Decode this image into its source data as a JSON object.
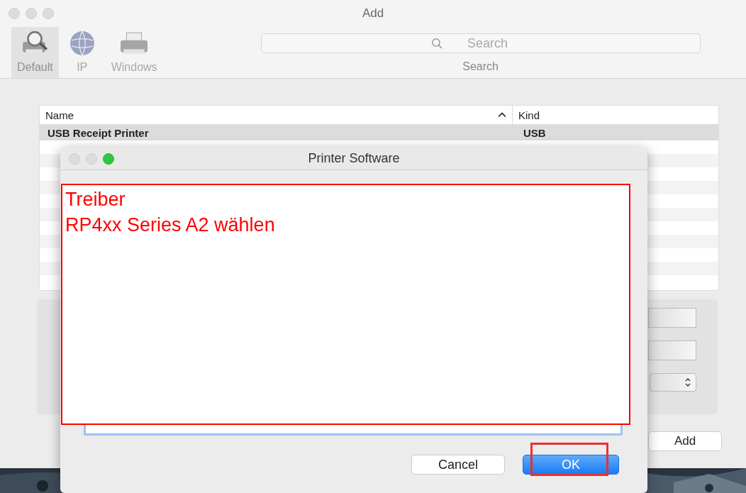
{
  "window": {
    "title": "Add",
    "toolbar": [
      {
        "label": "Default",
        "kind": "default",
        "selected": true
      },
      {
        "label": "IP",
        "kind": "ip",
        "selected": false
      },
      {
        "label": "Windows",
        "kind": "windows",
        "selected": false
      }
    ],
    "search": {
      "placeholder": "Search",
      "label": "Search"
    }
  },
  "table": {
    "columns": [
      "Name",
      "Kind"
    ],
    "rows": [
      {
        "name": "USB Receipt Printer",
        "kind": "USB",
        "selected": true
      }
    ]
  },
  "add_button": "Add",
  "dialog": {
    "title": "Printer Software",
    "buttons": [
      {
        "label": "Cancel",
        "kind": "secondary"
      },
      {
        "label": "OK",
        "kind": "primary"
      }
    ]
  },
  "annotation": {
    "lines": [
      "Treiber",
      "RP4xx Series A2 wählen"
    ]
  }
}
